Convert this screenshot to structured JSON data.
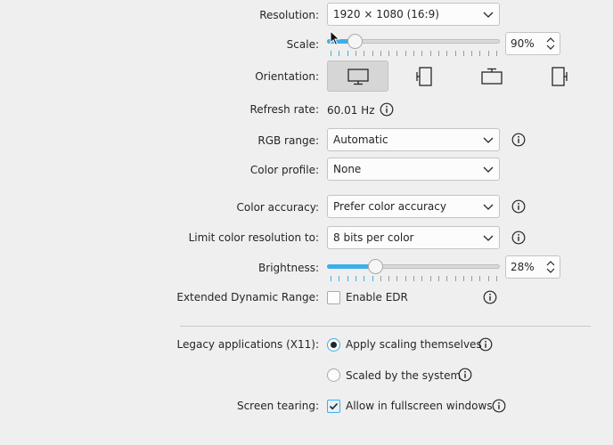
{
  "resolution": {
    "label": "Resolution:",
    "value": "1920 × 1080 (16:9)"
  },
  "scale": {
    "label": "Scale:",
    "value": "90%",
    "level_percent": 16
  },
  "orientation": {
    "label": "Orientation:",
    "options": [
      "landscape-icon",
      "portrait-icon",
      "landscape-flipped-icon",
      "portrait-flipped-icon"
    ],
    "selected": 0
  },
  "refresh_rate": {
    "label": "Refresh rate:",
    "value": "60.01 Hz"
  },
  "rgb_range": {
    "label": "RGB range:",
    "value": "Automatic"
  },
  "color_profile": {
    "label": "Color profile:",
    "value": "None"
  },
  "color_accuracy": {
    "label": "Color accuracy:",
    "value": "Prefer color accuracy"
  },
  "color_resolution": {
    "label": "Limit color resolution to:",
    "value": "8 bits per color"
  },
  "brightness": {
    "label": "Brightness:",
    "value": "28%",
    "level_percent": 28
  },
  "edr": {
    "label": "Extended Dynamic Range:",
    "option": "Enable EDR",
    "checked": false
  },
  "legacy": {
    "label": "Legacy applications (X11):",
    "option_apply": "Apply scaling themselves",
    "option_system": "Scaled by the system",
    "selected": "apply"
  },
  "tearing": {
    "label": "Screen tearing:",
    "option": "Allow in fullscreen windows",
    "checked": true
  },
  "colors": {
    "accent": "#3daee9",
    "background": "#efefef",
    "text": "#232629"
  }
}
